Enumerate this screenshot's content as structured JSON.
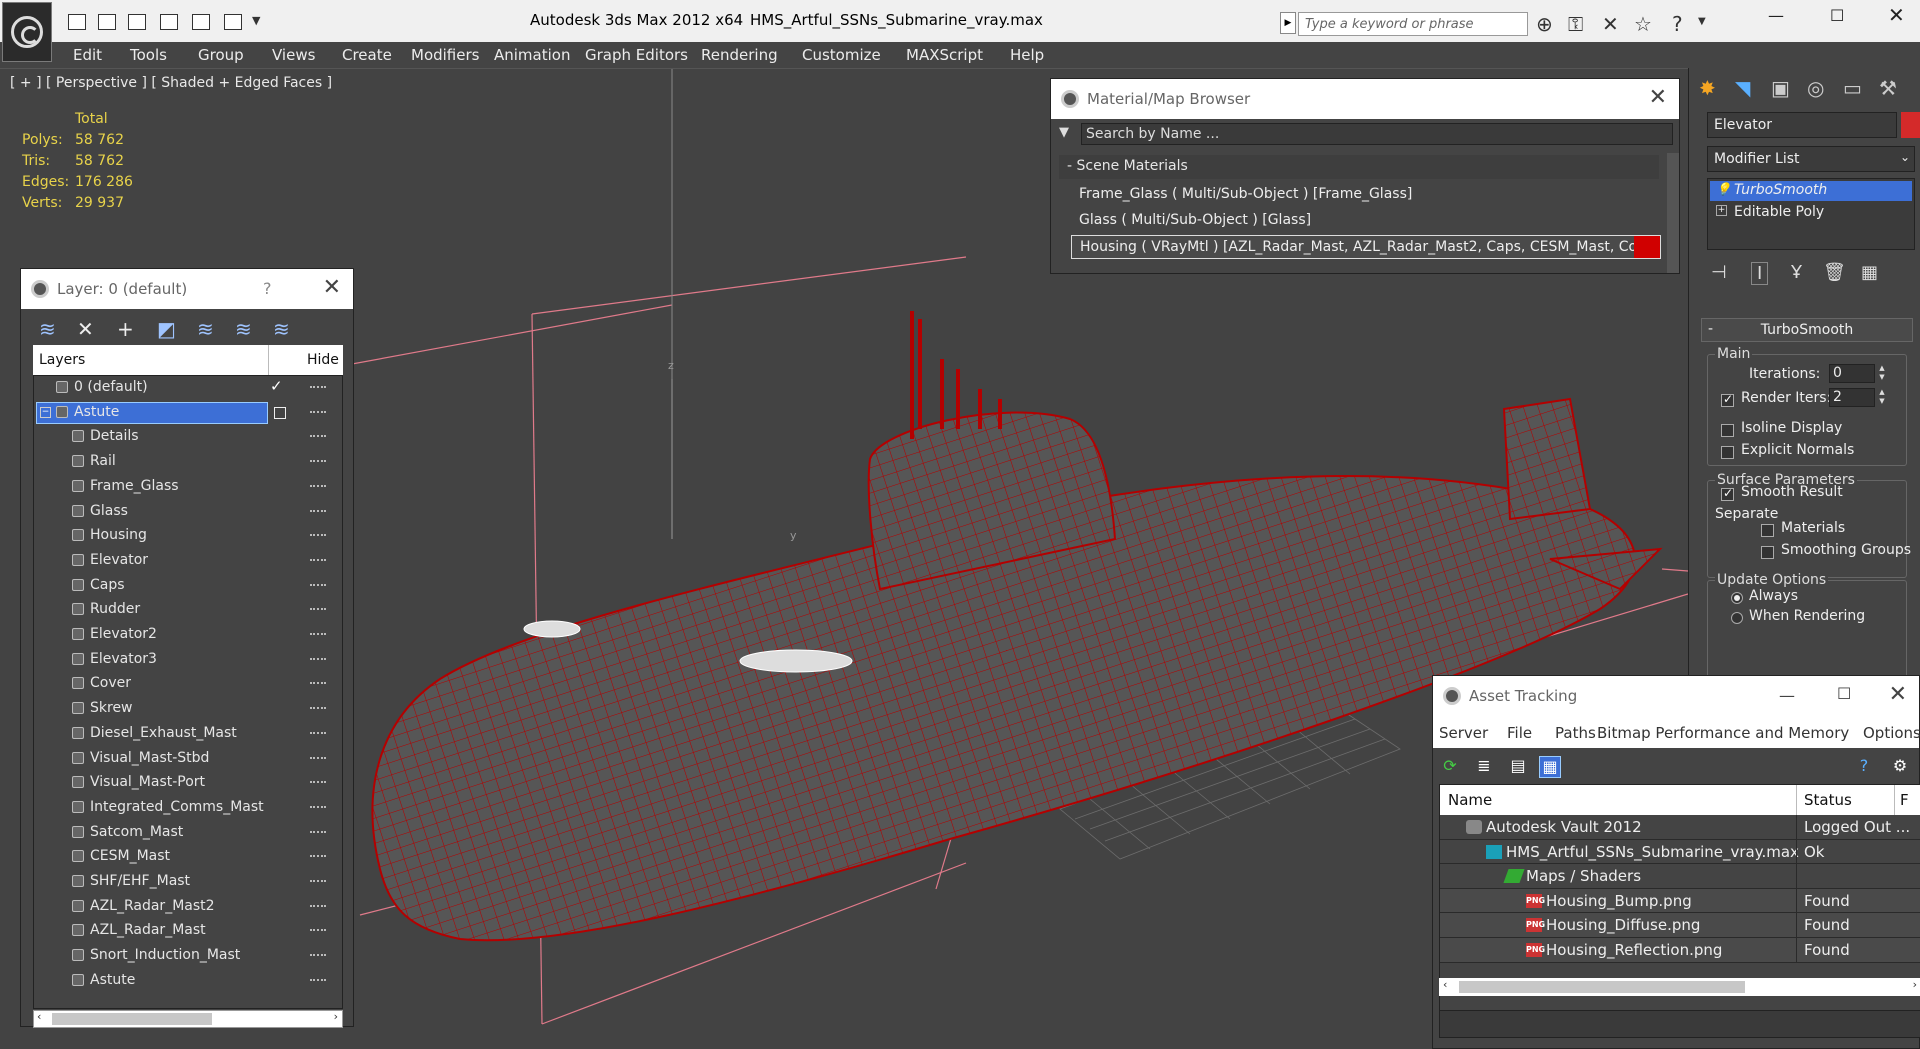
{
  "titlebar": {
    "app_title": "Autodesk 3ds Max  2012 x64",
    "file_title": "HMS_Artful_SSNs_Submarine_vray.max",
    "search_placeholder": "Type a keyword or phrase"
  },
  "menu": [
    "Edit",
    "Tools",
    "Group",
    "Views",
    "Create",
    "Modifiers",
    "Animation",
    "Graph Editors",
    "Rendering",
    "Customize",
    "MAXScript",
    "Help"
  ],
  "viewport": {
    "label": "[ + ] [ Perspective ] [ Shaded + Edged Faces ]",
    "stats_header": "Total",
    "stats": [
      {
        "label": "Polys:",
        "value": "58 762"
      },
      {
        "label": "Tris:",
        "value": "58 762"
      },
      {
        "label": "Edges:",
        "value": "176 286"
      },
      {
        "label": "Verts:",
        "value": "29 937"
      }
    ],
    "gizmo_axis_z": "z",
    "gizmo_axis_y": "y"
  },
  "layer_panel": {
    "title": "Layer: 0 (default)",
    "help": "?",
    "col_layers": "Layers",
    "col_hide": "Hide",
    "layers": [
      {
        "name": "0 (default)",
        "level": 0
      },
      {
        "name": "Astute",
        "level": 0
      },
      {
        "name": "Details",
        "level": 1
      },
      {
        "name": "Rail",
        "level": 1
      },
      {
        "name": "Frame_Glass",
        "level": 1
      },
      {
        "name": "Glass",
        "level": 1
      },
      {
        "name": "Housing",
        "level": 1
      },
      {
        "name": "Elevator",
        "level": 1
      },
      {
        "name": "Caps",
        "level": 1
      },
      {
        "name": "Rudder",
        "level": 1
      },
      {
        "name": "Elevator2",
        "level": 1
      },
      {
        "name": "Elevator3",
        "level": 1
      },
      {
        "name": "Cover",
        "level": 1
      },
      {
        "name": "Skrew",
        "level": 1
      },
      {
        "name": "Diesel_Exhaust_Mast",
        "level": 1
      },
      {
        "name": "Visual_Mast-Stbd",
        "level": 1
      },
      {
        "name": "Visual_Mast-Port",
        "level": 1
      },
      {
        "name": "Integrated_Comms_Mast",
        "level": 1
      },
      {
        "name": "Satcom_Mast",
        "level": 1
      },
      {
        "name": "CESM_Mast",
        "level": 1
      },
      {
        "name": "SHF/EHF_Mast",
        "level": 1
      },
      {
        "name": "AZL_Radar_Mast2",
        "level": 1
      },
      {
        "name": "AZL_Radar_Mast",
        "level": 1
      },
      {
        "name": "Snort_Induction_Mast",
        "level": 1
      },
      {
        "name": "Astute",
        "level": 1
      }
    ]
  },
  "material_browser": {
    "title": "Material/Map Browser",
    "search_placeholder": "Search by Name ...",
    "section": "- Scene Materials",
    "materials": [
      "Frame_Glass  ( Multi/Sub-Object ) [Frame_Glass]",
      "Glass  ( Multi/Sub-Object ) [Glass]",
      "Housing  ( VRayMtl ) [AZL_Radar_Mast, AZL_Radar_Mast2, Caps, CESM_Mast, Cover,..."
    ]
  },
  "command_panel": {
    "object_name": "Elevator",
    "modifier_list": "Modifier List",
    "stack": [
      "TurboSmooth",
      "Editable Poly"
    ],
    "rollout_title": "TurboSmooth",
    "main_label": "Main",
    "iterations_label": "Iterations:",
    "iterations_value": "0",
    "render_iters_label": "Render Iters:",
    "render_iters_value": "2",
    "isoline_label": "Isoline Display",
    "explicit_normals_label": "Explicit Normals",
    "surface_params_label": "Surface Parameters",
    "smooth_result_label": "Smooth Result",
    "separate_label": "Separate",
    "materials_label": "Materials",
    "smoothing_groups_label": "Smoothing Groups",
    "update_options_label": "Update Options",
    "always_label": "Always",
    "when_rendering_label": "When Rendering",
    "object_color": "#d42a2a"
  },
  "asset_tracking": {
    "title": "Asset Tracking",
    "menu": [
      "Server",
      "File",
      "Paths",
      "Bitmap Performance and Memory",
      "Options"
    ],
    "col_name": "Name",
    "col_status": "Status",
    "col_extra": "F",
    "rows": [
      {
        "name": "Autodesk Vault 2012",
        "status": "Logged Out ...",
        "indent": 0,
        "icon": "vault-icon"
      },
      {
        "name": "HMS_Artful_SSNs_Submarine_vray.max",
        "status": "Ok",
        "indent": 1,
        "icon": "max-file-icon"
      },
      {
        "name": "Maps / Shaders",
        "status": "",
        "indent": 2,
        "icon": "maps-icon"
      },
      {
        "name": "Housing_Bump.png",
        "status": "Found",
        "indent": 3,
        "icon": "png-icon"
      },
      {
        "name": "Housing_Diffuse.png",
        "status": "Found",
        "indent": 3,
        "icon": "png-icon"
      },
      {
        "name": "Housing_Reflection.png",
        "status": "Found",
        "indent": 3,
        "icon": "png-icon"
      }
    ],
    "png_badge": "PNG"
  },
  "colors": {
    "wireframe": "#b40000",
    "selection": "#3d6fd6",
    "stats_text": "#e8d34a"
  }
}
